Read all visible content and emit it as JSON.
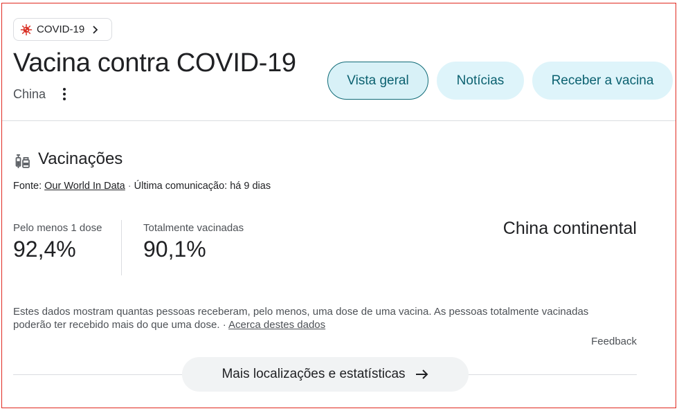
{
  "breadcrumb": {
    "label": "COVID-19"
  },
  "header": {
    "title": "Vacina contra COVID-19",
    "location": "China"
  },
  "tabs": [
    {
      "label": "Vista geral",
      "active": true
    },
    {
      "label": "Notícias",
      "active": false
    },
    {
      "label": "Receber a vacina",
      "active": false
    }
  ],
  "section": {
    "title": "Vacinações",
    "source_prefix": "Fonte: ",
    "source_link": "Our World In Data",
    "source_separator": " · ",
    "last_update": "Última comunicação: há 9 dias"
  },
  "stats": [
    {
      "label": "Pelo menos 1 dose",
      "value": "92,4%"
    },
    {
      "label": "Totalmente vacinadas",
      "value": "90,1%"
    }
  ],
  "region": "China continental",
  "note": {
    "text": "Estes dados mostram quantas pessoas receberam, pelo menos, uma dose de uma vacina. As pessoas totalmente vacinadas poderão ter recebido mais do que uma dose.",
    "separator": " · ",
    "link": "Acerca destes dados"
  },
  "feedback": "Feedback",
  "more_button": {
    "label": "Mais localizações e estatísticas"
  },
  "colors": {
    "accent_red": "#d93025",
    "tab_bg": "#def4fa",
    "tab_text": "#0b6170",
    "border": "#e0281e"
  },
  "icons": {
    "breadcrumb": "virus-icon",
    "breadcrumb_chevron": "chevron-right-icon",
    "menu": "more-vert-icon",
    "section": "vaccine-icon",
    "more_button": "arrow-right-icon"
  }
}
